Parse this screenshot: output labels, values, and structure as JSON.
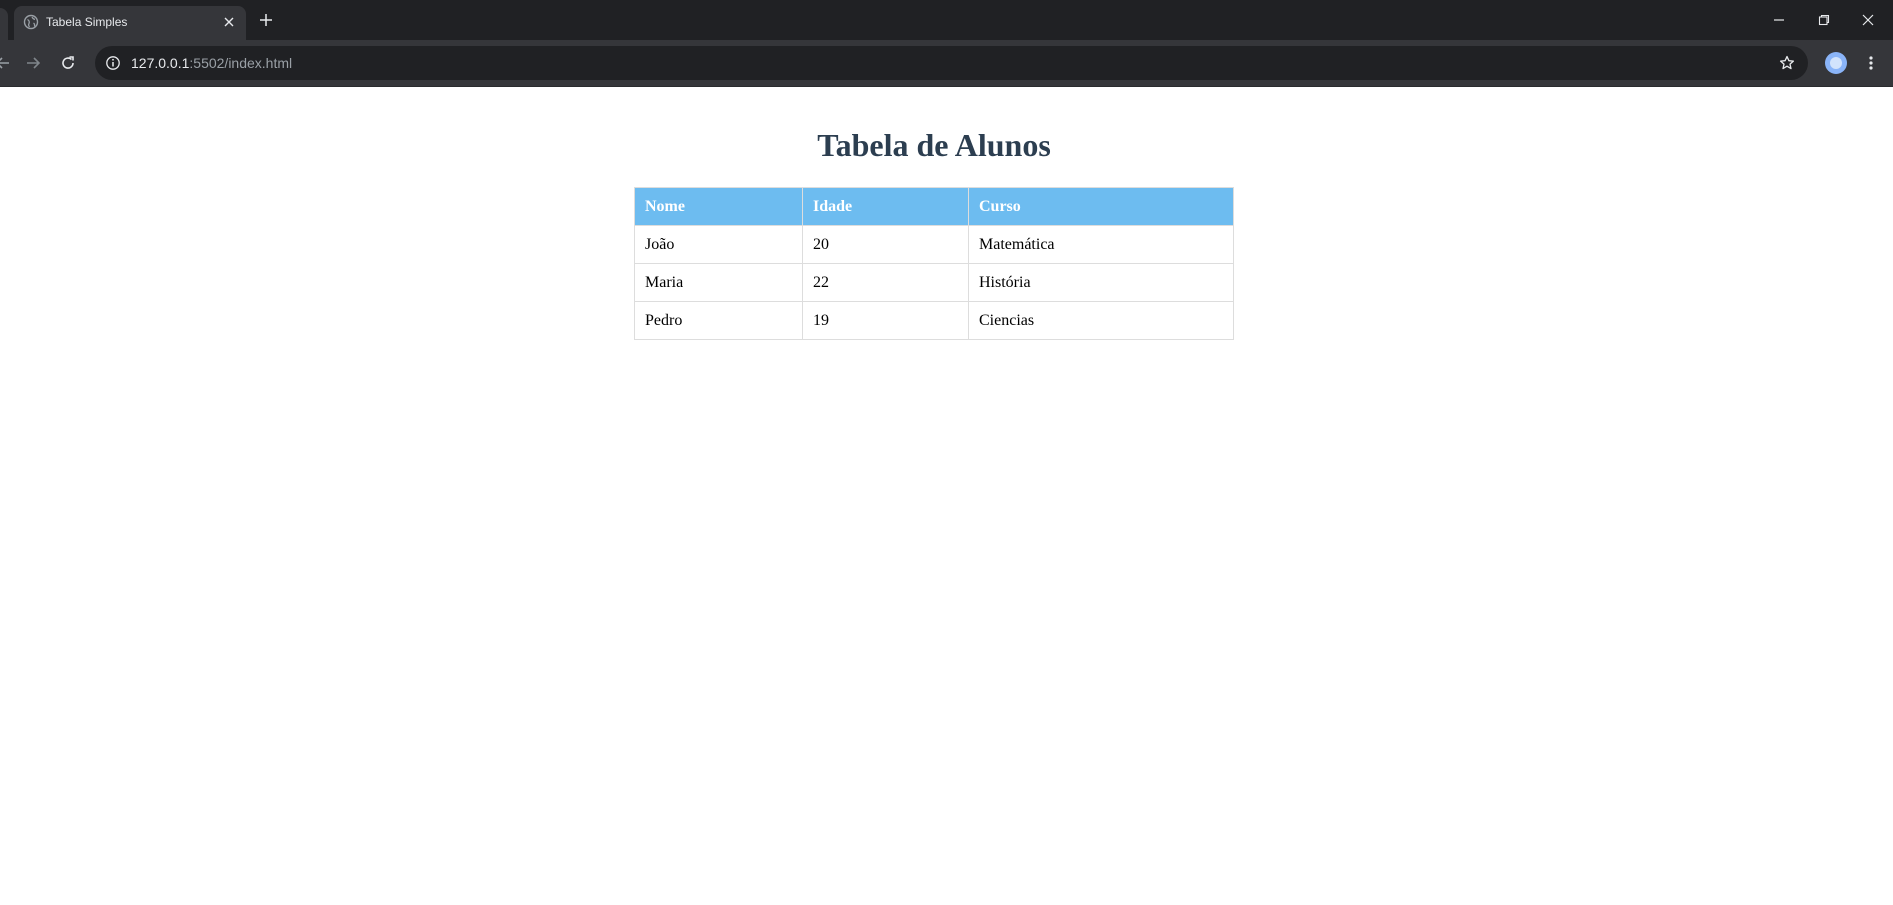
{
  "browser": {
    "tab": {
      "title": "Tabela Simples",
      "favicon": "globe-icon"
    },
    "address_bar": {
      "host": "127.0.0.1",
      "path": ":5502/index.html"
    }
  },
  "page": {
    "title": "Tabela de Alunos",
    "table": {
      "headers": [
        "Nome",
        "Idade",
        "Curso"
      ],
      "rows": [
        [
          "João",
          "20",
          "Matemática"
        ],
        [
          "Maria",
          "22",
          "História"
        ],
        [
          "Pedro",
          "19",
          "Ciencias"
        ]
      ]
    }
  },
  "colors": {
    "header_background": "#6dbcf0",
    "title_color": "#2c3e50"
  }
}
